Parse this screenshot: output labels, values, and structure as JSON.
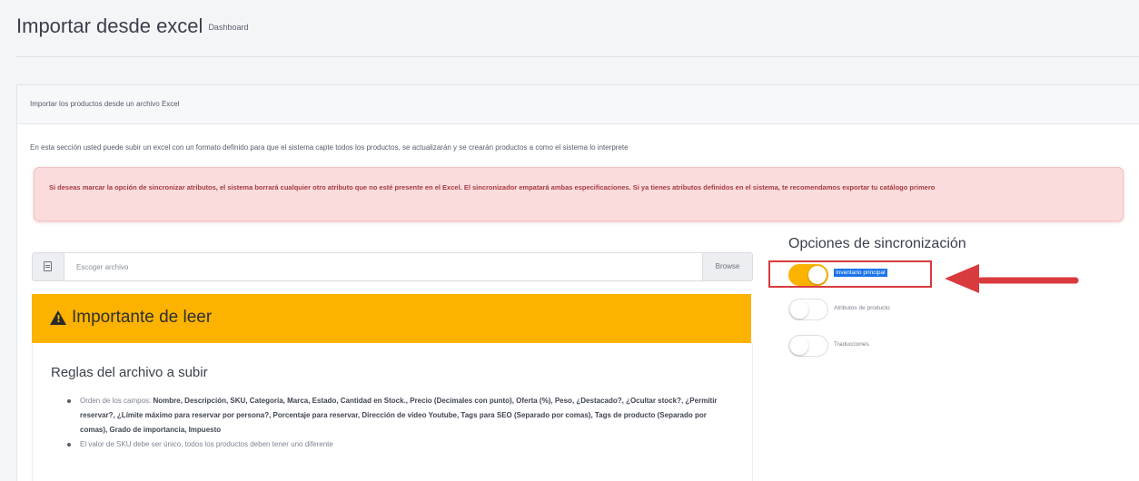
{
  "header": {
    "title": "Importar desde excel",
    "subtitle": "Dashboard"
  },
  "card": {
    "header_text": "Importar los productos desde un archivo Excel",
    "intro_text": "En esta sección usted puede subir un excel con un formato definido para que el sistema capte todos los productos, se actualizarán y se crearán productos a como el sistema lo interprete",
    "alert_text": "Si deseas marcar la opción de sincronizar atributos, el sistema borrará cualquier otro atributo que no esté presente en el Excel. El sincronizador empatará ambas especificaciones. Si ya tienes atributos definidos en el sistema, te recomendamos exportar tu catálogo primero"
  },
  "file_input": {
    "icon": "file-icon",
    "placeholder": "Escoger archivo",
    "browse_label": "Browse"
  },
  "important": {
    "icon": "warning-icon",
    "title": "Importante de leer",
    "color": "#fbb300"
  },
  "rules": {
    "title": "Reglas del archivo a subir",
    "items": [
      {
        "label": "Orden de los campos:",
        "text": "Nombre, Descripción, SKU, Categoría, Marca, Estado, Cantidad en Stock., Precio (Decimales con punto), Oferta (%), Peso, ¿Destacado?, ¿Ocultar stock?, ¿Permitir reservar?, ¿Límite máximo para reservar por persona?, Porcentaje para reservar, Dirección de video Youtube, Tags para SEO (Separado por comas), Tags de producto (Separado por comas), Grado de importancia, Impuesto"
      },
      {
        "label": "",
        "text": "El valor de SKU debe ser único, todos los productos deben tener uno diferente"
      }
    ]
  },
  "sync": {
    "title": "Opciones de sincronización",
    "options": [
      {
        "label": "Inventario principal",
        "on": true
      },
      {
        "label": "Atributos de producto",
        "on": false
      },
      {
        "label": "Traducciones",
        "on": false
      }
    ]
  },
  "annotation": {
    "highlight_color": "#d93a3d"
  }
}
